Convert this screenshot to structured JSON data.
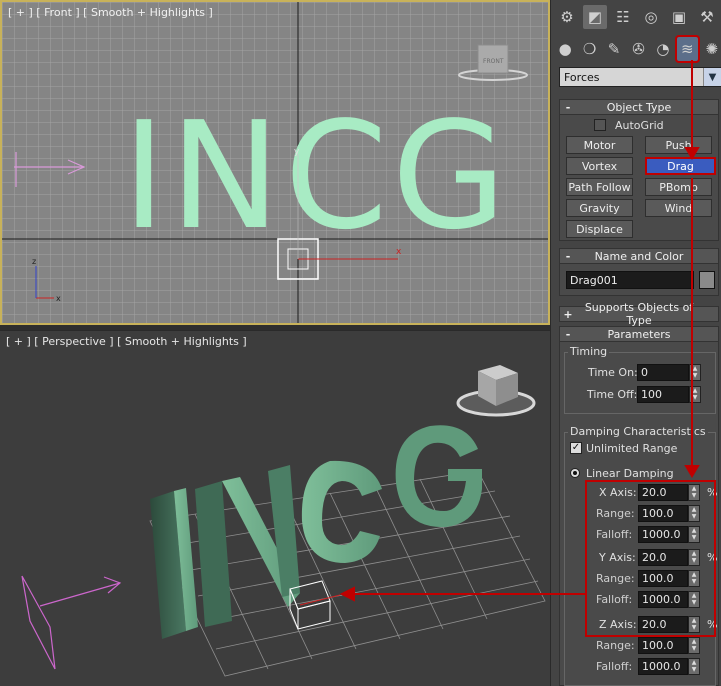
{
  "viewports": {
    "front": {
      "label": "[ + ] [ Front ] [ Smooth + Highlights ]",
      "nav_label": "FRONT",
      "text3d": "INCG"
    },
    "perspective": {
      "label": "[ + ] [ Perspective ] [ Smooth + Highlights ]",
      "text3d": "INCG"
    }
  },
  "command_panel": {
    "category_dropdown": "Forces",
    "object_type": {
      "title": "Object Type",
      "sign": "-",
      "autogrid_label": "AutoGrid",
      "buttons": [
        "Motor",
        "Push",
        "Vortex",
        "Drag",
        "Path Follow",
        "PBomb",
        "Gravity",
        "Wind",
        "Displace"
      ],
      "selected": "Drag"
    },
    "name_and_color": {
      "title": "Name and Color",
      "sign": "-",
      "name": "Drag001"
    },
    "supports_objects": {
      "title": "Supports Objects of Type",
      "sign": "+"
    },
    "parameters": {
      "title": "Parameters",
      "sign": "-",
      "timing": {
        "title": "Timing",
        "time_on_label": "Time On:",
        "time_on": "0",
        "time_off_label": "Time Off:",
        "time_off": "100"
      },
      "damping": {
        "title": "Damping Characteristics",
        "unlimited_range_label": "Unlimited Range",
        "linear_damping_label": "Linear Damping",
        "x_axis_label": "X Axis:",
        "x_axis": "20.0",
        "y_axis_label": "Y Axis:",
        "y_axis": "20.0",
        "z_axis_label": "Z Axis:",
        "z_axis": "20.0",
        "range_label": "Range:",
        "falloff_label": "Falloff:",
        "range_value": "100.0",
        "falloff_value": "1000.0",
        "percent": "%"
      }
    }
  },
  "colors": {
    "annotation_red": "#c00000",
    "text_mint": "#a8ebc4",
    "text_3d": "#6fa98a",
    "active_viewport_border": "#c8b25a",
    "selected_button": "#3a5cbf"
  }
}
